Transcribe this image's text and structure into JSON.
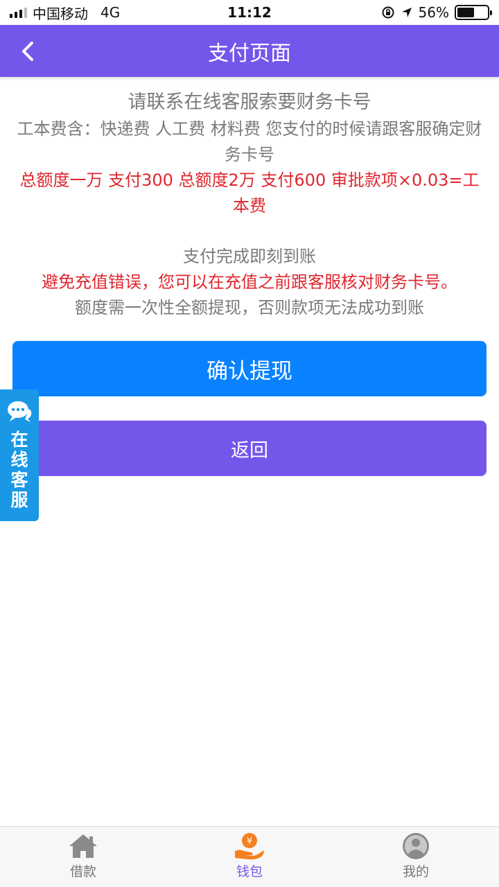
{
  "status_bar": {
    "carrier": "中国移动",
    "network": "4G",
    "time": "11:12",
    "battery": "56%",
    "battery_level": 0.56
  },
  "header": {
    "title": "支付页面"
  },
  "content": {
    "line1": "请联系在线客服索要财务卡号",
    "line2": "工本费含：快递费 人工费 材料费 您支付的时候请跟客服确定财务卡号",
    "line3": "总额度一万 支付300  总额度2万 支付600 审批款项×0.03=工本费",
    "line4": "支付完成即刻到账",
    "line5": "避免充值错误，您可以在充值之前跟客服核对财务卡号。",
    "line6": "额度需一次性全额提现，否则款项无法成功到账"
  },
  "buttons": {
    "confirm": "确认提现",
    "back": "返回"
  },
  "online_service": {
    "label": "在线客服"
  },
  "tabbar": {
    "items": [
      {
        "label": "借款",
        "icon": "house-icon"
      },
      {
        "label": "钱包",
        "icon": "wallet-hand-icon"
      },
      {
        "label": "我的",
        "icon": "user-icon"
      }
    ],
    "active_index": 1
  },
  "colors": {
    "primary": "#7556eb",
    "confirm": "#0a82ff",
    "warning": "#e0262e",
    "service": "#1a98e6",
    "wallet_orange": "#f5801f"
  }
}
